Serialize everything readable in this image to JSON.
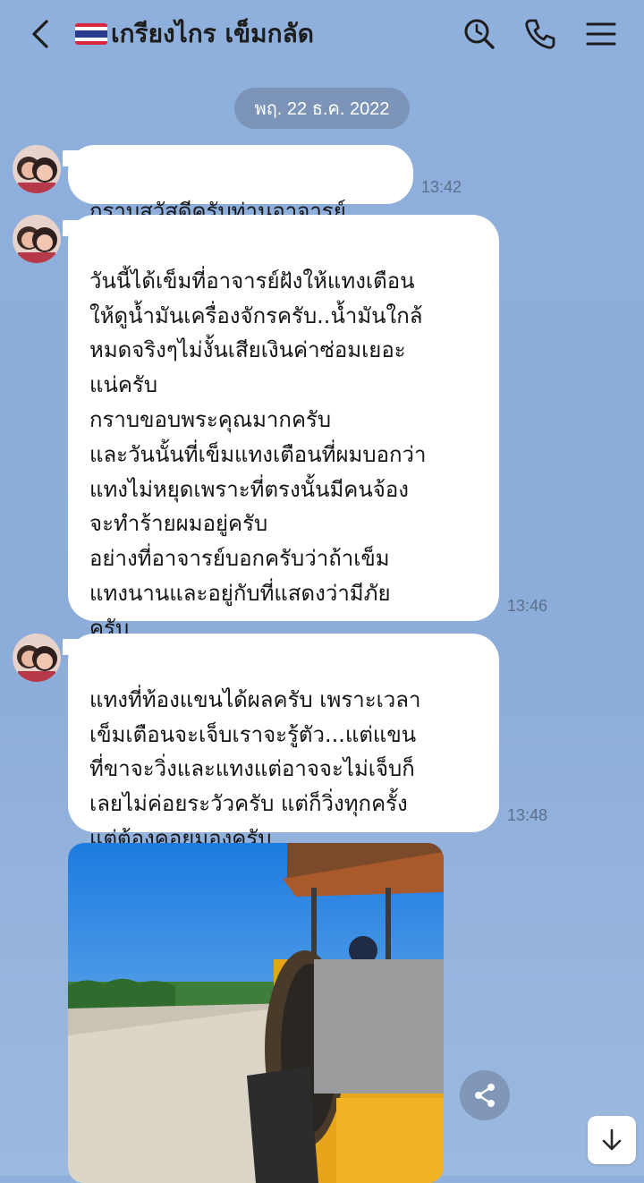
{
  "header": {
    "flag_emoji": "🇹🇭",
    "contact_name": "เกรียงไกร เข็มกลัด",
    "icons": [
      "back-chevron-icon",
      "search-icon",
      "phone-icon",
      "menu-icon"
    ]
  },
  "date_separator": "พฤ. 22 ธ.ค. 2022",
  "messages": [
    {
      "text": "กราบสวัสดีครับท่านอาจารย์",
      "time": "13:42"
    },
    {
      "text": "วันนี้ได้เข็มที่อาจารย์ฝังให้แทงเตือน\nให้ดูน้ำมันเครื่องจักรครับ..น้ำมันใกล้\nหมดจริงๆไม่งั้นเสียเงินค่าซ่อมเยอะ\nแน่ครับ\nกราบขอบพระคุณมากครับ\nและวันนั้นที่เข็มแทงเตือนที่ผมบอกว่า\nแทงไม่หยุดเพราะที่ตรงนั้นมีคนจ้อง\nจะทำร้ายผมอยู่ครับ\nอย่างที่อาจารย์บอกครับว่าถ้าเข็ม\nแทงนานและอยู่กับที่แสดงว่ามีภัย\nครับ",
      "time": "13:46"
    },
    {
      "text": "แทงที่ท้องแขนได้ผลครับ เพราะเวลา\nเข็มเตือนจะเจ็บเราจะรู้ตัว...แต่แขน\nที่ขาจะวิ่งและแทงแต่อาจจะไม่เจ็บก็\nเลยไม่ค่อยระวัวครับ แต่ก็วิ่งทุกครั้ง\nแต่ต้องคอยมองครับ",
      "time": "13:48"
    }
  ],
  "photo": {
    "subject": "road-roller-photo"
  },
  "controls": {
    "share_icon": "share-icon",
    "scroll_down_icon": "arrow-down-icon"
  },
  "colors": {
    "background": "#8fb0dc",
    "bubble": "#ffffff",
    "date_pill": "#7b94b8",
    "time_text": "#5b6f8c"
  }
}
